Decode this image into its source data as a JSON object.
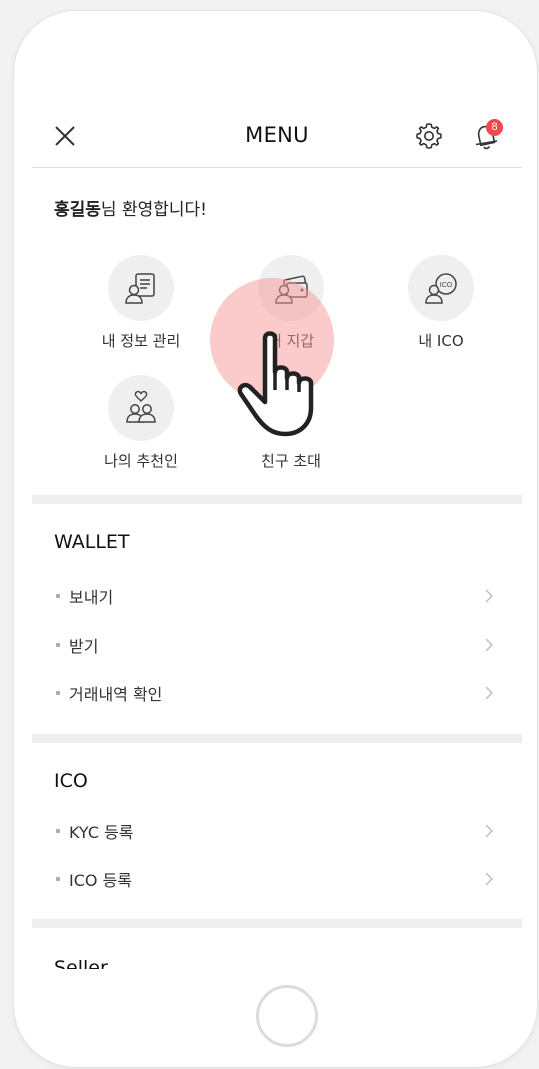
{
  "header": {
    "title": "MENU",
    "notification_count": "8"
  },
  "welcome": {
    "name": "홍길동",
    "suffix": "님 환영합니다!"
  },
  "quick_menu": [
    {
      "label": "내 정보 관리",
      "icon": "profile-document-icon"
    },
    {
      "label": "내 지갑",
      "icon": "wallet-icon"
    },
    {
      "label": "내 ICO",
      "icon": "ico-coin-icon"
    },
    {
      "label": "나의 추천인",
      "icon": "referral-people-icon"
    },
    {
      "label": "친구 초대",
      "icon": ""
    }
  ],
  "sections": [
    {
      "title": "WALLET",
      "items": [
        "보내기",
        "받기",
        "거래내역 확인"
      ]
    },
    {
      "title": "ICO",
      "items": [
        "KYC 등록",
        "ICO 등록"
      ]
    }
  ],
  "cut_section_title": "Seller",
  "colors": {
    "badge": "#f04a4a",
    "touch_highlight": "#f89696"
  }
}
